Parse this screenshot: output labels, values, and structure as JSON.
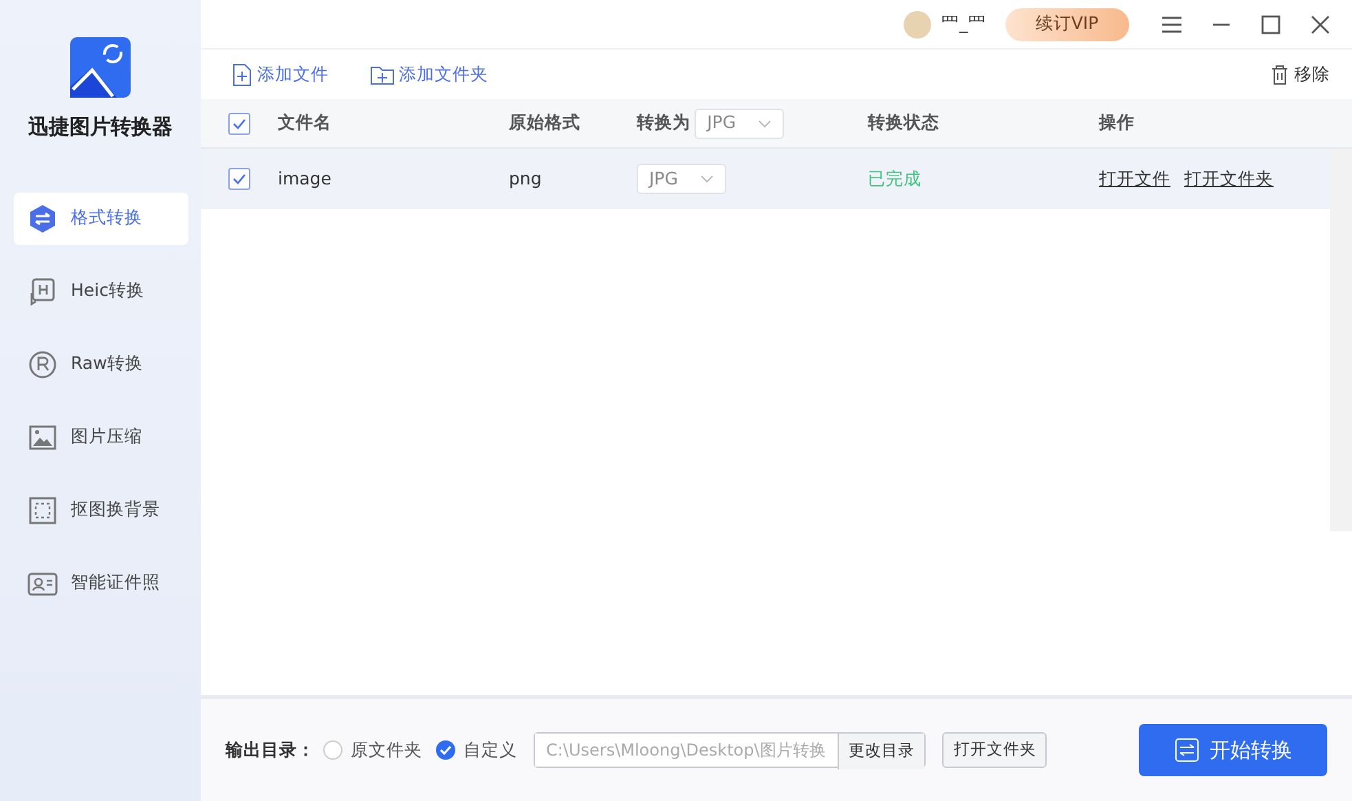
{
  "app": {
    "title": "迅捷图片转换器"
  },
  "sidebar": {
    "items": [
      {
        "label": "格式转换",
        "selected": true
      },
      {
        "label": "Heic转换",
        "selected": false
      },
      {
        "label": "Raw转换",
        "selected": false
      },
      {
        "label": "图片压缩",
        "selected": false
      },
      {
        "label": "抠图换背景",
        "selected": false
      },
      {
        "label": "智能证件照",
        "selected": false
      }
    ]
  },
  "header": {
    "user_name": "罒_罒",
    "vip_button": "续订VIP"
  },
  "toolbar": {
    "add_file": "添加文件",
    "add_folder": "添加文件夹",
    "remove": "移除"
  },
  "table": {
    "all_checked": true,
    "columns": [
      "文件名",
      "原始格式",
      "转换为",
      "转换状态",
      "操作"
    ],
    "header_target": "JPG",
    "rows": [
      {
        "checked": true,
        "name": "image",
        "format": "png",
        "target": "JPG",
        "status": "已完成",
        "actions": [
          "打开文件",
          "打开文件夹"
        ]
      }
    ]
  },
  "footer": {
    "label": "输出目录：",
    "options": [
      {
        "label": "原文件夹",
        "selected": false
      },
      {
        "label": "自定义",
        "selected": true
      }
    ],
    "path": "C:\\Users\\Mloong\\Desktop\\图片转换",
    "change_button": "更改目录",
    "open_button": "打开文件夹",
    "start_button": "开始转换"
  }
}
